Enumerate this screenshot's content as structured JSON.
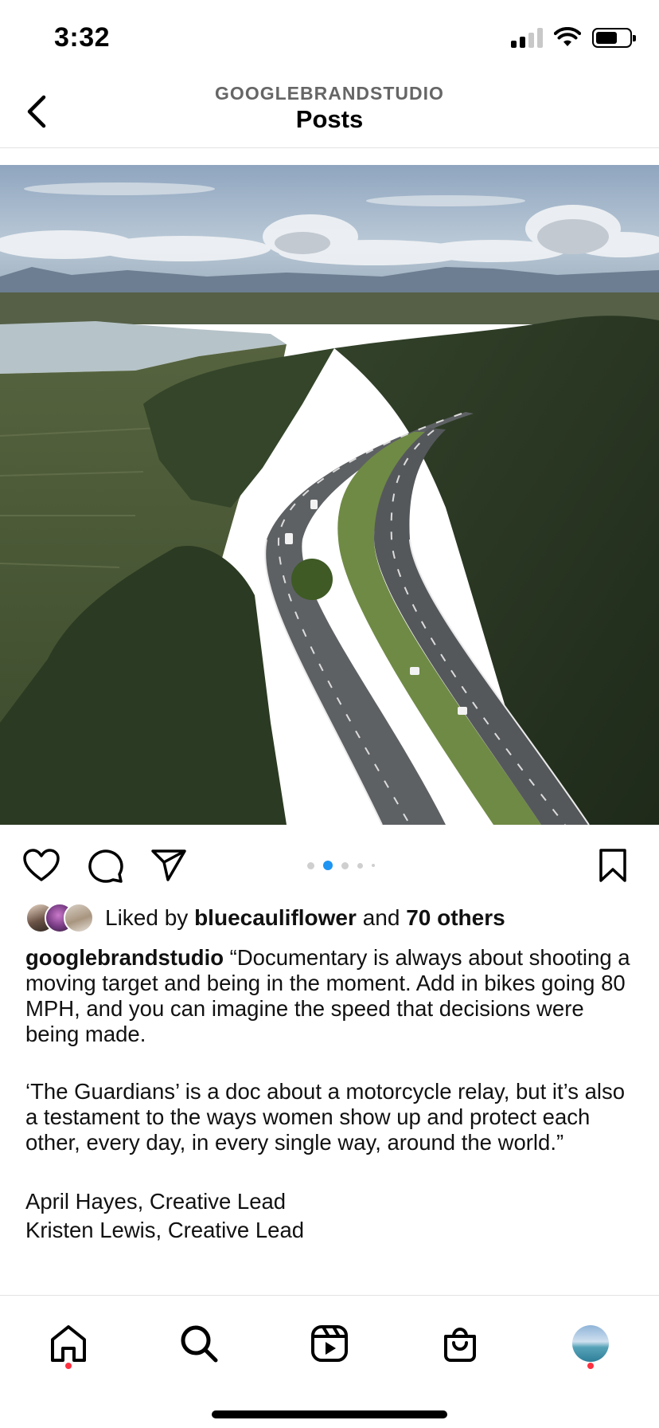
{
  "status_bar": {
    "time": "3:32",
    "icons": [
      "cellular-signal-icon",
      "wifi-icon",
      "battery-icon"
    ]
  },
  "header": {
    "account": "GOOGLEBRANDSTUDIO",
    "title": "Posts",
    "back_icon": "chevron-left-icon"
  },
  "post": {
    "image_description_icon": "photo",
    "carousel": {
      "count": 5,
      "active_index": 1
    },
    "actions": [
      "heart-icon",
      "comment-icon",
      "share-icon",
      "bookmark-icon"
    ],
    "likes": {
      "prefix": "Liked by",
      "user": "bluecauliflower",
      "joiner": "and",
      "others": "70 others"
    },
    "caption": {
      "username": "googlebrandstudio",
      "para1": "“Documentary is always about shooting a moving target and being in the moment. Add in bikes going 80 MPH, and you can imagine the speed that decisions were being made.",
      "para2": "‘The Guardians’ is a doc about a motorcycle relay, but it’s also a testament to the ways women show up and protect each other, every day, in every single way, around the world.”",
      "credit1": "April Hayes, Creative Lead",
      "credit2": "Kristen Lewis, Creative Lead"
    }
  },
  "tabbar": {
    "tabs": [
      "home-icon",
      "search-icon",
      "reels-icon",
      "shop-icon",
      "profile-avatar"
    ],
    "notification_color": "#ff3040"
  },
  "colors": {
    "carousel_active": "#1e95f2",
    "notification": "#ff3040"
  }
}
